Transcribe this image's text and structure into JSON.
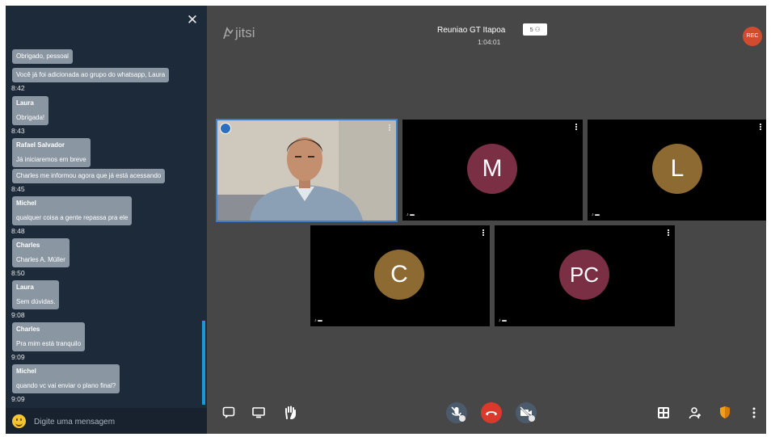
{
  "chat": {
    "messages": [
      {
        "sender": "",
        "lines": [
          "Obrigado, pessoal"
        ],
        "time": ""
      },
      {
        "sender": "",
        "lines": [
          "Você já foi adicionada ao grupo do whatsapp, Laura"
        ],
        "time": "8:42"
      },
      {
        "sender": "Laura",
        "lines": [
          "Obrigada!"
        ],
        "time": "8:43"
      },
      {
        "sender": "Rafael Salvador",
        "lines": [
          "Já iniciaremos em breve"
        ],
        "time": ""
      },
      {
        "sender": "",
        "lines": [
          "Charles me informou agora que já está acessando"
        ],
        "time": "8:45"
      },
      {
        "sender": "Michel",
        "lines": [
          "qualquer coisa a gente repassa pra ele"
        ],
        "time": "8:48"
      },
      {
        "sender": "Charles",
        "lines": [
          "Charles A. Müller"
        ],
        "time": "8:50"
      },
      {
        "sender": "Laura",
        "lines": [
          "Sem dúvidas."
        ],
        "time": "9:08"
      },
      {
        "sender": "Charles",
        "lines": [
          "Pra mim está tranquilo"
        ],
        "time": "9:09"
      },
      {
        "sender": "Michel",
        "lines": [
          "quando vc vai enviar o plano final?"
        ],
        "time": "9:09"
      }
    ],
    "input_placeholder": "Digite uma mensagem"
  },
  "header": {
    "logo": "jitsi",
    "meeting_title": "Reuniao GT Itapoa",
    "participant_badge": "5",
    "timer": "1:04:01",
    "rec_label": "REC"
  },
  "tiles": [
    {
      "id": "self",
      "initials": "",
      "name": "",
      "color": "#3d7ec7"
    },
    {
      "id": "m",
      "initials": "M",
      "name": "",
      "color": "#7a2f44"
    },
    {
      "id": "l",
      "initials": "L",
      "name": "",
      "color": "#8c6a32"
    },
    {
      "id": "c",
      "initials": "C",
      "name": "",
      "color": "#8c6a32"
    },
    {
      "id": "pc",
      "initials": "PC",
      "name": "",
      "color": "#7a2f44"
    }
  ],
  "colors": {
    "hangup": "#d93a2b",
    "accent": "#1d97d7"
  }
}
